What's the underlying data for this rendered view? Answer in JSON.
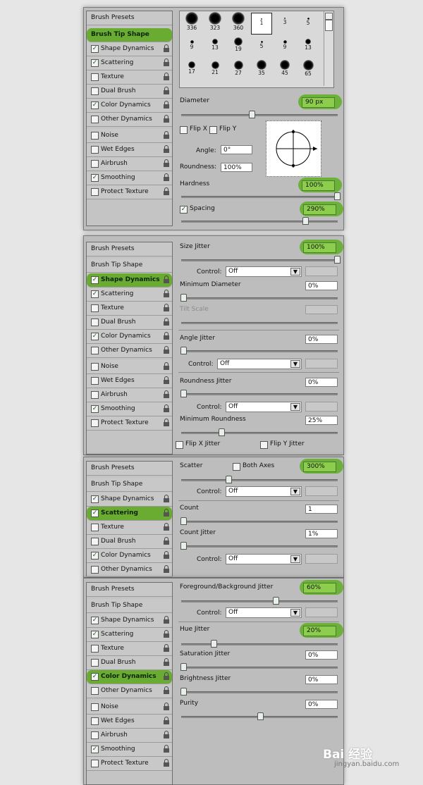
{
  "sidebar_common": {
    "brush_presets": "Brush Presets",
    "brush_tip_shape": "Brush Tip Shape",
    "items": [
      "Shape Dynamics",
      "Scattering",
      "Texture",
      "Dual Brush",
      "Color Dynamics",
      "Other Dynamics",
      "Noise",
      "Wet Edges",
      "Airbrush",
      "Smoothing",
      "Protect Texture"
    ],
    "checked": [
      true,
      true,
      false,
      false,
      true,
      false,
      false,
      false,
      false,
      true,
      false
    ]
  },
  "panel1": {
    "brush_tips": [
      {
        "label": "336"
      },
      {
        "label": "323"
      },
      {
        "label": "360"
      },
      {
        "label": "1"
      },
      {
        "label": "3"
      },
      {
        "label": "5"
      },
      {
        "label": "9"
      },
      {
        "label": "13"
      },
      {
        "label": "19"
      },
      {
        "label": "5"
      },
      {
        "label": "9"
      },
      {
        "label": "13"
      },
      {
        "label": "17"
      },
      {
        "label": "21"
      },
      {
        "label": "27"
      },
      {
        "label": "35"
      },
      {
        "label": "45"
      },
      {
        "label": "65"
      }
    ],
    "diameter_label": "Diameter",
    "diameter_value": "90 px",
    "flip_x": "Flip X",
    "flip_y": "Flip Y",
    "angle_label": "Angle:",
    "angle_value": "0°",
    "roundness_label": "Roundness:",
    "roundness_value": "100%",
    "hardness_label": "Hardness",
    "hardness_value": "100%",
    "spacing_label": "Spacing",
    "spacing_value": "290%",
    "diameter_level": 0.33,
    "hardness_level": 1.0,
    "spacing_level": 0.79
  },
  "panel2": {
    "size_jitter_label": "Size Jitter",
    "size_jitter_value": "100%",
    "control_label": "Control:",
    "control_value": "Off",
    "min_diameter_label": "Minimum Diameter",
    "min_diameter_value": "0%",
    "tilt_scale_label": "Tilt Scale",
    "angle_jitter_label": "Angle Jitter",
    "angle_jitter_value": "0%",
    "roundness_jitter_label": "Roundness Jitter",
    "roundness_jitter_value": "0%",
    "min_roundness_label": "Minimum Roundness",
    "min_roundness_value": "25%",
    "flip_x_jitter": "Flip X Jitter",
    "flip_y_jitter": "Flip Y Jitter"
  },
  "panel3": {
    "scatter_label": "Scatter",
    "both_axes": "Both Axes",
    "scatter_value": "300%",
    "control_label": "Control:",
    "control_value": "Off",
    "count_label": "Count",
    "count_value": "1",
    "count_jitter_label": "Count Jitter",
    "count_jitter_value": "1%"
  },
  "panel4": {
    "fg_bg_label": "Foreground/Background Jitter",
    "fg_bg_value": "60%",
    "control_label": "Control:",
    "control_value": "Off",
    "hue_label": "Hue Jitter",
    "hue_value": "20%",
    "saturation_label": "Saturation Jitter",
    "saturation_value": "0%",
    "brightness_label": "Brightness Jitter",
    "brightness_value": "0%",
    "purity_label": "Purity",
    "purity_value": "0%"
  },
  "watermark": {
    "main": "Bai 经验",
    "sub": "jingyan.baidu.com"
  },
  "colors": {
    "accent": "#6cb13a",
    "panel": "#bdbdbd"
  }
}
